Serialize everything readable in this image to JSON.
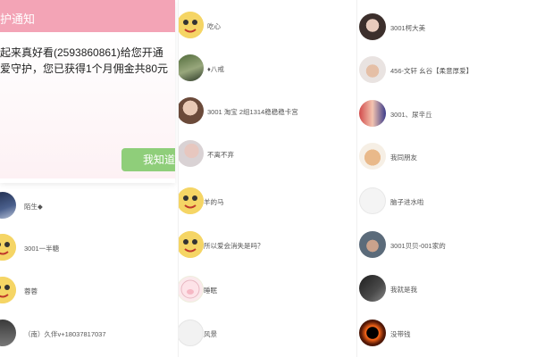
{
  "dialog": {
    "title": "护通知",
    "message_line1": "起来真好看(2593860861)给您开通",
    "message_line2": "爱守护，您已获得1个月佣金共80元",
    "ok_label": "我知道"
  },
  "left_list": [
    {
      "name": "陌生◆",
      "avatar": "night-sky-avatar"
    },
    {
      "name": "3001一半糖",
      "avatar": "cartoon-avatar"
    },
    {
      "name": "蓉蓉",
      "avatar": "cartoon-avatar"
    },
    {
      "name": "（南）久伴v+18037817037",
      "avatar": "man-avatar"
    }
  ],
  "mid_list": [
    {
      "name": "吃心",
      "avatar": "cartoon-avatar"
    },
    {
      "name": "♦八戒",
      "avatar": "landscape-avatar"
    },
    {
      "name": "3001 淘宝 2组1314稳稳稳卡宫",
      "avatar": "woman-avatar"
    },
    {
      "name": "不离不弃",
      "avatar": "woman-avatar"
    },
    {
      "name": "羊的马",
      "avatar": "cartoon-avatar"
    },
    {
      "name": "所以爱会消失是吗？",
      "avatar": "cartoon-avatar"
    },
    {
      "name": "睡眠",
      "avatar": "pig-avatar"
    },
    {
      "name": "风景",
      "avatar": "blank-avatar"
    }
  ],
  "right_list": [
    {
      "name": "3001柯大美",
      "avatar": "woman-avatar"
    },
    {
      "name": "456-文轩 幺谷【柔意厚爱】",
      "avatar": "man-avatar"
    },
    {
      "name": "3001、尿辛丘",
      "avatar": "couple-avatar"
    },
    {
      "name": "我同朋友",
      "avatar": "dog-avatar"
    },
    {
      "name": "脑子进水啦",
      "avatar": "blank-avatar"
    },
    {
      "name": "3001贝贝-001家的",
      "avatar": "man-avatar"
    },
    {
      "name": "我就是我",
      "avatar": "dark-avatar"
    },
    {
      "name": "没带钱",
      "avatar": "eclipse-avatar"
    }
  ],
  "colors": {
    "dialog_header": "#f3a4b6",
    "ok_button": "#8fce7a"
  }
}
